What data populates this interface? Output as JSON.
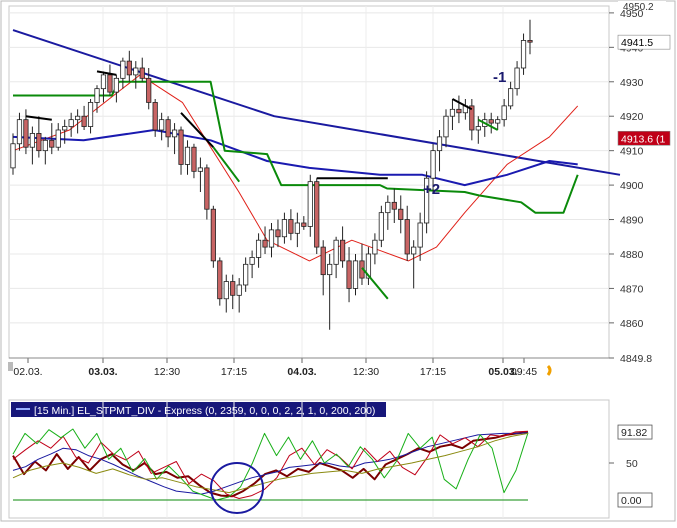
{
  "chart_data": [
    {
      "type": "candlestick",
      "ylim": [
        4849.8,
        4952
      ],
      "y_ticks": [
        "4950",
        "4940",
        "4930",
        "4920",
        "4910",
        "4900",
        "4890",
        "4880",
        "4870",
        "4860",
        "4849.8"
      ],
      "top_cut_label": "4950.2",
      "x_ticks": [
        "02.03.",
        "03.03.",
        "12:30",
        "17:15",
        "04.03.",
        "12:30",
        "17:15",
        "05.03.",
        "09:45"
      ],
      "x_tick_bold": [
        false,
        true,
        false,
        false,
        true,
        false,
        false,
        true,
        false
      ],
      "price_labels": [
        {
          "text": "4941.5",
          "value": 4941.5,
          "color": "#ffffff",
          "text_color": "#000000"
        },
        {
          "text": "4913.6 (1",
          "value": 4913.6,
          "color": "#c00018",
          "text_color": "#ffffff"
        }
      ],
      "annotations": [
        "-1",
        "+2"
      ],
      "candles": [
        [
          4905,
          4915,
          4903,
          4912
        ],
        [
          4912,
          4921,
          4910,
          4919
        ],
        [
          4919,
          4922,
          4909,
          4911
        ],
        [
          4911,
          4917,
          4906,
          4915
        ],
        [
          4915,
          4920,
          4908,
          4910
        ],
        [
          4910,
          4914,
          4906,
          4913
        ],
        [
          4913,
          4918,
          4909,
          4911
        ],
        [
          4911,
          4918,
          4910,
          4916
        ],
        [
          4916,
          4919,
          4912,
          4917
        ],
        [
          4917,
          4921,
          4914,
          4919
        ],
        [
          4919,
          4922,
          4915,
          4920
        ],
        [
          4920,
          4923,
          4916,
          4917
        ],
        [
          4917,
          4925,
          4915,
          4924
        ],
        [
          4924,
          4929,
          4921,
          4928
        ],
        [
          4928,
          4933,
          4924,
          4932
        ],
        [
          4932,
          4935,
          4926,
          4927
        ],
        [
          4927,
          4932,
          4924,
          4931
        ],
        [
          4931,
          4937,
          4928,
          4936
        ],
        [
          4936,
          4939,
          4930,
          4932
        ],
        [
          4932,
          4936,
          4928,
          4934
        ],
        [
          4934,
          4937,
          4930,
          4931
        ],
        [
          4931,
          4934,
          4922,
          4924
        ],
        [
          4924,
          4925,
          4914,
          4916
        ],
        [
          4916,
          4921,
          4913,
          4919
        ],
        [
          4919,
          4920,
          4911,
          4914
        ],
        [
          4914,
          4918,
          4909,
          4916
        ],
        [
          4916,
          4917,
          4903,
          4906
        ],
        [
          4906,
          4913,
          4903,
          4911
        ],
        [
          4911,
          4912,
          4902,
          4904
        ],
        [
          4904,
          4908,
          4898,
          4905
        ],
        [
          4905,
          4906,
          4890,
          4893
        ],
        [
          4893,
          4894,
          4876,
          4878
        ],
        [
          4878,
          4879,
          4865,
          4867
        ],
        [
          4867,
          4874,
          4863,
          4872
        ],
        [
          4872,
          4874,
          4864,
          4868
        ],
        [
          4868,
          4873,
          4863,
          4871
        ],
        [
          4871,
          4879,
          4869,
          4877
        ],
        [
          4877,
          4881,
          4873,
          4879
        ],
        [
          4879,
          4886,
          4876,
          4884
        ],
        [
          4884,
          4888,
          4880,
          4882
        ],
        [
          4882,
          4889,
          4879,
          4887
        ],
        [
          4887,
          4890,
          4882,
          4885
        ],
        [
          4885,
          4892,
          4883,
          4890
        ],
        [
          4890,
          4893,
          4884,
          4886
        ],
        [
          4886,
          4892,
          4882,
          4889
        ],
        [
          4889,
          4891,
          4887,
          4888
        ],
        [
          4888,
          4903,
          4885,
          4901
        ],
        [
          4901,
          4902,
          4880,
          4882
        ],
        [
          4882,
          4884,
          4868,
          4874
        ],
        [
          4874,
          4880,
          4858,
          4877
        ],
        [
          4877,
          4885,
          4873,
          4884
        ],
        [
          4884,
          4888,
          4876,
          4878
        ],
        [
          4878,
          4882,
          4866,
          4870
        ],
        [
          4870,
          4880,
          4868,
          4878
        ],
        [
          4878,
          4883,
          4871,
          4873
        ],
        [
          4873,
          4882,
          4871,
          4880
        ],
        [
          4880,
          4886,
          4877,
          4884
        ],
        [
          4884,
          4894,
          4882,
          4892
        ],
        [
          4892,
          4897,
          4887,
          4895
        ],
        [
          4895,
          4899,
          4889,
          4893
        ],
        [
          4893,
          4897,
          4886,
          4890
        ],
        [
          4890,
          4894,
          4878,
          4880
        ],
        [
          4880,
          4884,
          4870,
          4882
        ],
        [
          4882,
          4892,
          4878,
          4889
        ],
        [
          4889,
          4904,
          4886,
          4902
        ],
        [
          4902,
          4912,
          4898,
          4910
        ],
        [
          4910,
          4916,
          4904,
          4914
        ],
        [
          4914,
          4922,
          4911,
          4920
        ],
        [
          4920,
          4925,
          4916,
          4922
        ],
        [
          4922,
          4926,
          4918,
          4921
        ],
        [
          4921,
          4925,
          4919,
          4923
        ],
        [
          4923,
          4925,
          4913,
          4916
        ],
        [
          4916,
          4920,
          4912,
          4917
        ],
        [
          4917,
          4921,
          4914,
          4919
        ],
        [
          4919,
          4921,
          4915,
          4918
        ],
        [
          4918,
          4920,
          4916,
          4919
        ],
        [
          4919,
          4925,
          4917,
          4923
        ],
        [
          4923,
          4930,
          4922,
          4928
        ],
        [
          4928,
          4936,
          4926,
          4934
        ],
        [
          4934,
          4944,
          4932,
          4942
        ],
        [
          4942,
          4948,
          4938,
          4941.5
        ]
      ],
      "overlays": [
        {
          "name": "trend",
          "color": "#1a1aa0",
          "width": 2,
          "points": [
            [
              0,
              4945
            ],
            [
              37,
              4920
            ],
            [
              86,
              4903
            ]
          ]
        },
        {
          "name": "ma_fast",
          "color": "#e02018",
          "width": 1,
          "points": [
            [
              0,
              4910
            ],
            [
              8,
              4916
            ],
            [
              18,
              4932
            ],
            [
              24,
              4924
            ],
            [
              32,
              4898
            ],
            [
              36,
              4884
            ],
            [
              42,
              4878
            ],
            [
              48,
              4884
            ],
            [
              56,
              4878
            ],
            [
              60,
              4882
            ],
            [
              64,
              4892
            ],
            [
              70,
              4906
            ],
            [
              76,
              4914
            ],
            [
              80,
              4923
            ]
          ]
        },
        {
          "name": "ma_slow",
          "color": "#1a1ab0",
          "width": 2,
          "points": [
            [
              0,
              4914
            ],
            [
              10,
              4913
            ],
            [
              20,
              4916
            ],
            [
              28,
              4913
            ],
            [
              36,
              4907
            ],
            [
              42,
              4905
            ],
            [
              52,
              4903
            ],
            [
              58,
              4903
            ],
            [
              64,
              4900
            ],
            [
              70,
              4903
            ],
            [
              76,
              4907
            ],
            [
              80,
              4906
            ]
          ]
        },
        {
          "name": "stop",
          "color": "#0a8a0a",
          "width": 2,
          "points": [
            [
              0,
              4926
            ],
            [
              14,
              4926
            ],
            [
              15,
              4930
            ],
            [
              28,
              4930
            ],
            [
              30,
              4910
            ],
            [
              36,
              4909
            ],
            [
              38,
              4900
            ],
            [
              52,
              4900
            ],
            [
              53,
              4899
            ],
            [
              64,
              4898
            ],
            [
              66,
              4897
            ],
            [
              72,
              4895
            ],
            [
              74,
              4892
            ],
            [
              78,
              4892
            ],
            [
              80,
              4903
            ]
          ]
        }
      ],
      "drawn_lines": [
        {
          "color": "#000000",
          "points": [
            [
              2,
              4920
            ],
            [
              6,
              4919
            ]
          ]
        },
        {
          "color": "#000000",
          "points": [
            [
              13,
              4933
            ],
            [
              16,
              4932
            ]
          ]
        },
        {
          "color": "#000000",
          "points": [
            [
              26,
              4921
            ],
            [
              31,
              4911
            ]
          ]
        },
        {
          "color": "#000000",
          "points": [
            [
              47,
              4902
            ],
            [
              58,
              4902
            ]
          ]
        },
        {
          "color": "#000000",
          "points": [
            [
              68,
              4925
            ],
            [
              71,
              4922
            ]
          ]
        },
        {
          "color": "#0a8a0a",
          "points": [
            [
              31,
              4911
            ],
            [
              35,
              4901
            ]
          ]
        },
        {
          "color": "#0a8a0a",
          "points": [
            [
              54,
              4876
            ],
            [
              58,
              4867
            ]
          ]
        },
        {
          "color": "#0a8a0a",
          "points": [
            [
              72,
              4919
            ],
            [
              75,
              4916
            ]
          ]
        }
      ]
    },
    {
      "type": "line",
      "title": "[15 Min.] EL_STPMT_DIV - Express  (0, 2359, 0, 0, 0, 2, 2, 1, 0, 200, 200)",
      "ylim": [
        0,
        100
      ],
      "y_ticks": [
        "50"
      ],
      "value_labels": [
        "91.82",
        "0.00"
      ],
      "series": [
        {
          "color": "#7a0000",
          "width": 2,
          "values": [
            60,
            35,
            52,
            40,
            62,
            42,
            58,
            40,
            55,
            62,
            48,
            40,
            50,
            35,
            38,
            30,
            32,
            20,
            10,
            6,
            5,
            12,
            22,
            35,
            40,
            32,
            42,
            38,
            50,
            45,
            40,
            30,
            42,
            28,
            48,
            55,
            62,
            70,
            65,
            72,
            75,
            70,
            80,
            82,
            84,
            88,
            90,
            91.82
          ]
        },
        {
          "color": "#1a1aa0",
          "width": 1,
          "values": [
            40,
            45,
            55,
            62,
            70,
            68,
            60,
            55,
            48,
            40,
            32,
            25,
            18,
            12,
            10,
            8,
            12,
            18,
            24,
            30,
            34,
            38,
            44,
            46,
            48,
            50,
            46,
            44,
            50,
            52,
            55,
            60,
            66,
            72,
            76,
            80,
            84,
            88,
            89,
            90,
            90,
            91
          ]
        },
        {
          "color": "#c00018",
          "width": 1,
          "values": [
            55,
            68,
            80,
            70,
            86,
            58,
            50,
            78,
            62,
            54,
            66,
            36,
            44,
            52,
            22,
            35,
            26,
            8,
            2,
            6,
            14,
            30,
            60,
            70,
            48,
            68,
            58,
            42,
            70,
            52,
            66,
            44,
            34,
            58,
            88,
            76,
            84,
            72,
            88,
            86,
            92,
            93
          ]
        },
        {
          "color": "#18b018",
          "width": 1,
          "values": [
            62,
            90,
            76,
            95,
            84,
            96,
            70,
            90,
            55,
            70,
            38,
            56,
            28,
            46,
            30,
            12,
            6,
            0,
            4,
            18,
            50,
            90,
            60,
            85,
            55,
            80,
            50,
            62,
            45,
            72,
            55,
            30,
            52,
            90,
            70,
            85,
            28,
            15,
            55,
            88,
            70,
            10,
            40,
            91
          ]
        },
        {
          "color": "#8a8a10",
          "width": 1,
          "values": [
            30,
            40,
            46,
            50,
            44,
            36,
            42,
            34,
            28,
            30,
            24,
            18,
            14,
            10,
            16,
            22,
            28,
            32,
            36,
            38,
            40,
            36,
            42,
            46,
            50,
            55,
            60,
            66,
            72,
            80,
            86,
            90
          ]
        },
        {
          "color": "#0a8a0a",
          "width": 1,
          "values": [
            0,
            0
          ]
        }
      ],
      "highlight": "circle"
    }
  ]
}
